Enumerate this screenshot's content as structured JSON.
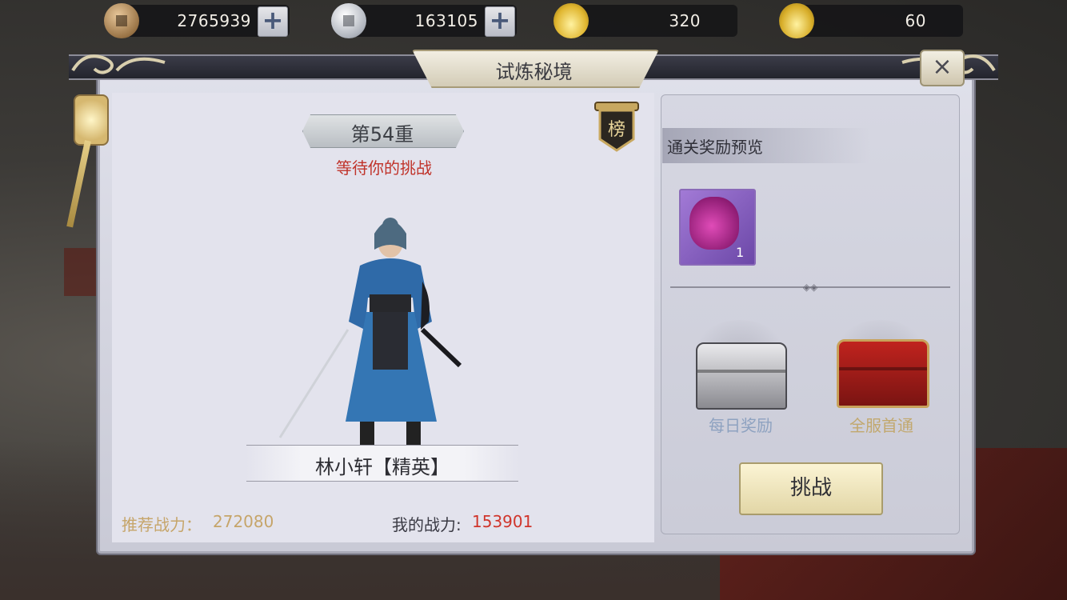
{
  "currencies": [
    {
      "icon": "bronze-coin-icon",
      "value": "2765939",
      "has_plus": true
    },
    {
      "icon": "silver-coin-icon",
      "value": "163105",
      "has_plus": true
    },
    {
      "icon": "gold-ingot-icon",
      "value": "320",
      "has_plus": false
    },
    {
      "icon": "locked-gold-ingot-icon",
      "value": "60",
      "has_plus": false
    }
  ],
  "plus_symbol": "+",
  "dialog": {
    "title": "试炼秘境",
    "close_symbol": "×"
  },
  "stage": {
    "label": "第54重",
    "status": "等待你的挑战",
    "rank_char": "榜"
  },
  "enemy": {
    "name": "林小轩【精英】"
  },
  "power": {
    "recommended_label": "推荐战力：",
    "recommended_value": "272080",
    "mine_label": "我的战力:",
    "mine_value": "153901"
  },
  "rewards": {
    "header": "通关奖励预览",
    "items": [
      {
        "icon": "purple-reward-bag-icon",
        "quantity": "1"
      }
    ],
    "divider_ornament": "◈◈",
    "chests": [
      {
        "icon": "silver-chest-icon",
        "label": "每日奖励"
      },
      {
        "icon": "red-gold-chest-icon",
        "label": "全服首通"
      }
    ]
  },
  "actions": {
    "challenge_label": "挑战"
  }
}
